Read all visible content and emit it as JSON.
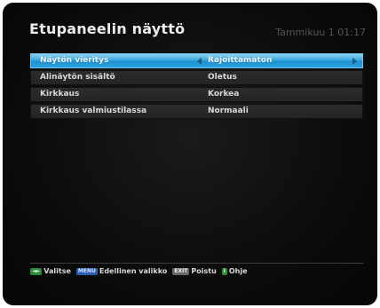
{
  "header": {
    "title": "Etupaneelin näyttö",
    "clock": "Tammikuu 1 01:17"
  },
  "menu": {
    "rows": [
      {
        "label": "Näytön vieritys",
        "value": "Rajoittamaton",
        "selected": true
      },
      {
        "label": "Alinäytön sisältö",
        "value": "Oletus",
        "selected": false
      },
      {
        "label": "Kirkkaus",
        "value": "Korkea",
        "selected": false
      },
      {
        "label": "Kirkkaus valmiustilassa",
        "value": "Normaali",
        "selected": false
      }
    ]
  },
  "footer": {
    "select_key": "◄►",
    "select_label": "Valitse",
    "menu_key": "MENU",
    "menu_label": "Edellinen valikko",
    "exit_key": "EXIT",
    "exit_label": "Poistu",
    "help_key": "i",
    "help_label": "Ohje"
  },
  "colors": {
    "selected_row": "#36a8e0",
    "background": "#0c0c0c",
    "row": "#2c2c2c"
  }
}
